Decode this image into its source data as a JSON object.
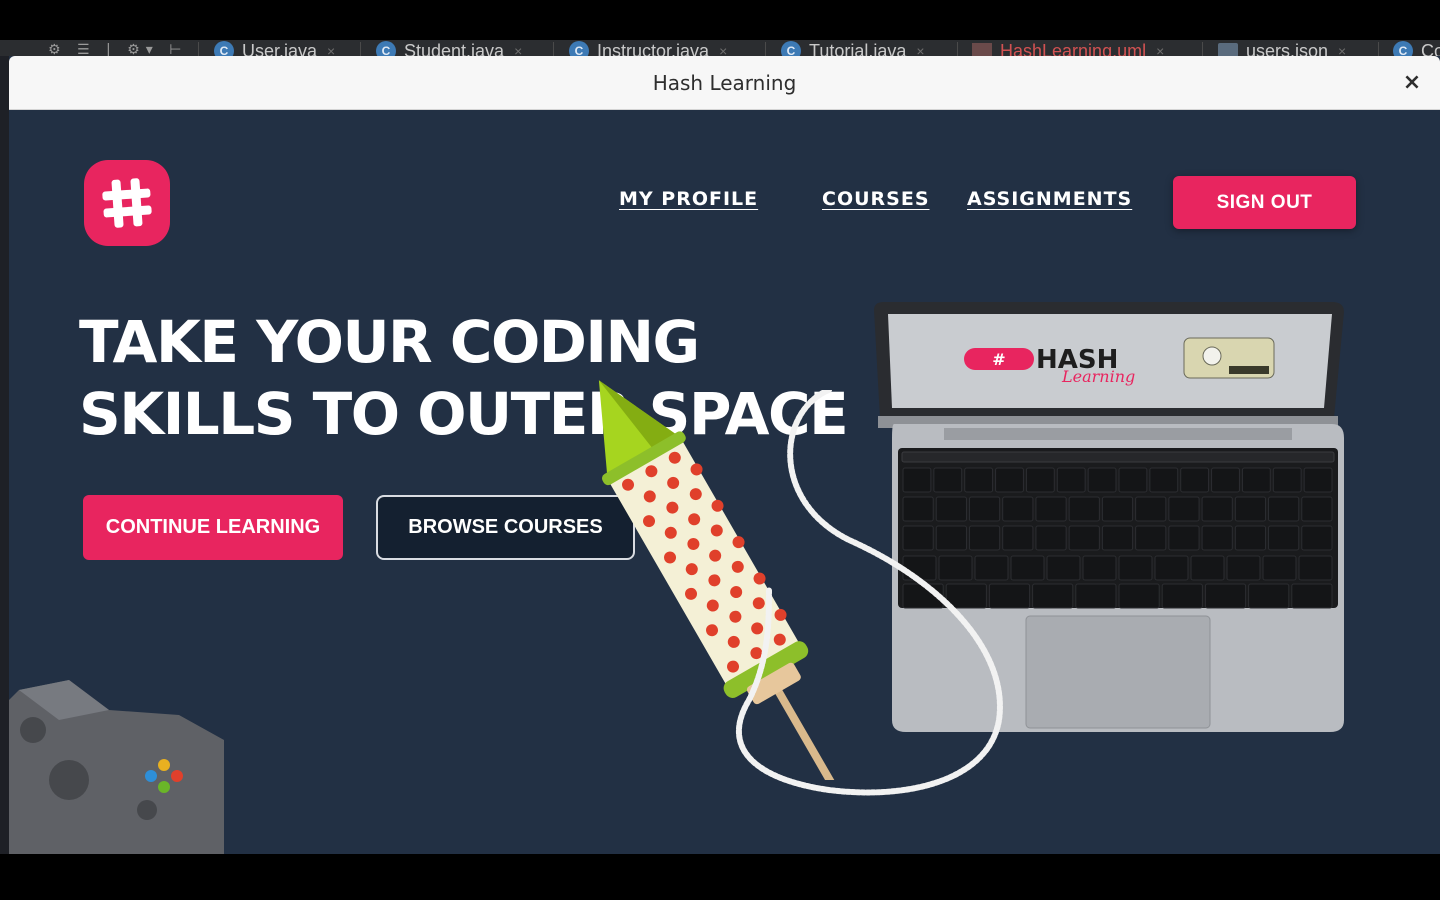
{
  "ide": {
    "tabs": [
      {
        "label": "User.java",
        "badge": "C"
      },
      {
        "label": "Student.java",
        "badge": "C"
      },
      {
        "label": "Instructor.java",
        "badge": "C"
      },
      {
        "label": "Tutorial.java",
        "badge": "C"
      },
      {
        "label": "HashLearning.uml",
        "badge": ""
      },
      {
        "label": "users.json",
        "badge": ""
      },
      {
        "label": "Co",
        "badge": "C"
      }
    ],
    "close_glyph": "×"
  },
  "window": {
    "title": "Hash Learning",
    "close_label": "×"
  },
  "nav": {
    "profile": "MY PROFILE",
    "courses": "COURSES",
    "assignments": "ASSIGNMENTS",
    "signout": "SIGN OUT"
  },
  "hero": {
    "line1": "TAKE YOUR CODING",
    "line2": "SKILLS TO OUTER SPACE",
    "continue_label": "CONTINUE LEARNING",
    "browse_label": "BROWSE COURSES"
  },
  "laptop_screen": {
    "brand": "HASH",
    "brand_script": "Learning"
  },
  "colors": {
    "accent": "#e8255f",
    "background": "#223044",
    "dark_button": "#142030",
    "titlebar": "#f7f7f7"
  },
  "icons": {
    "logo": "hashtag-icon",
    "close": "close-icon",
    "rocket": "rocket-illustration",
    "laptop": "laptop-illustration",
    "gamepad": "gamepad-illustration"
  }
}
